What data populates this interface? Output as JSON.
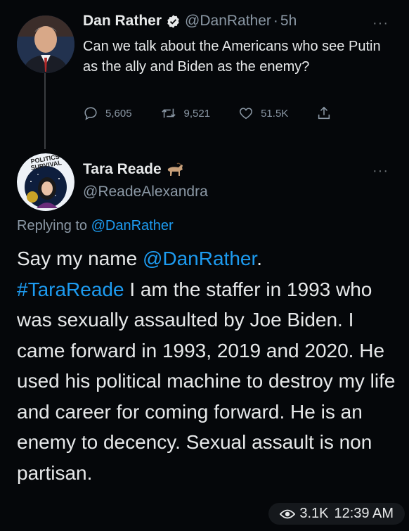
{
  "tweet1": {
    "name": "Dan Rather",
    "handle": "@DanRather",
    "separator": "·",
    "time": "5h",
    "text": "Can we talk about the Americans who see Putin as the ally and Biden as the enemy?",
    "replies": "5,605",
    "retweets": "9,521",
    "likes": "51.5K",
    "more": "···"
  },
  "tweet2": {
    "name": "Tara Reade",
    "handle": "@ReadeAlexandra",
    "more": "···",
    "avatar_text": "POLITICS SURVIVAL",
    "replying_label": "Replying to",
    "replying_handle": "@DanRather",
    "text_part1": "Say my name ",
    "mention": "@DanRather",
    "text_part2": ".",
    "hashtag": "#TaraReade",
    "text_part3": " I am the staffer in 1993 who was sexually assaulted by Joe Biden. I came forward in 1993, 2019 and 2020. He used his political machine to destroy my life and career for coming forward. He is an enemy to decency. Sexual assault is non partisan."
  },
  "footer": {
    "views": "3.1K",
    "time": "12:39 AM"
  },
  "colors": {
    "background": "#05070a",
    "accent": "#1d9bf0",
    "muted": "#8b98a5"
  },
  "icons": [
    "verified-icon",
    "reply-icon",
    "retweet-icon",
    "like-icon",
    "share-icon",
    "more-icon",
    "goat-emoji",
    "eye-icon"
  ]
}
